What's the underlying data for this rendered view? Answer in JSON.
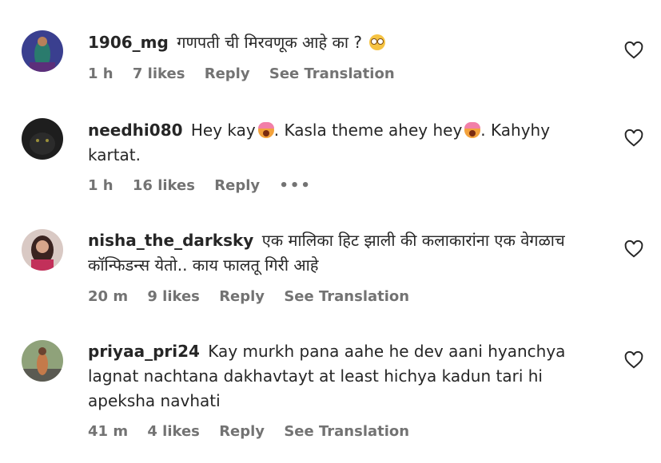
{
  "comments": [
    {
      "username": "1906_mg",
      "text": "गणपती ची मिरवणूक आहे का ?",
      "emoji": "flushed-face",
      "time": "1 h",
      "likes": "7 likes",
      "reply": "Reply",
      "translate": "See Translation"
    },
    {
      "username": "needhi080",
      "text_part1": "Hey kay",
      "text_part2": ". Kasla theme ahey hey",
      "text_part3": ". Kahyhy kartat.",
      "emoji": "face-screaming-in-fear",
      "time": "1 h",
      "likes": "16 likes",
      "reply": "Reply",
      "more": "•••"
    },
    {
      "username": "nisha_the_darksky",
      "text": "एक मालिका हिट झाली की कलाकारांना एक वेगळाच कॉन्फिडन्स येतो.. काय फालतू गिरी आहे",
      "time": "20 m",
      "likes": "9 likes",
      "reply": "Reply",
      "translate": "See Translation"
    },
    {
      "username": "priyaa_pri24",
      "text": "Kay murkh pana aahe he dev aani hyanchya lagnat nachtana dakhavtayt at least hichya kadun tari hi apeksha navhati",
      "time": "41 m",
      "likes": "4 likes",
      "reply": "Reply",
      "translate": "See Translation"
    }
  ],
  "icons": {
    "like": "heart-outline-icon",
    "options": "more-options-icon"
  }
}
